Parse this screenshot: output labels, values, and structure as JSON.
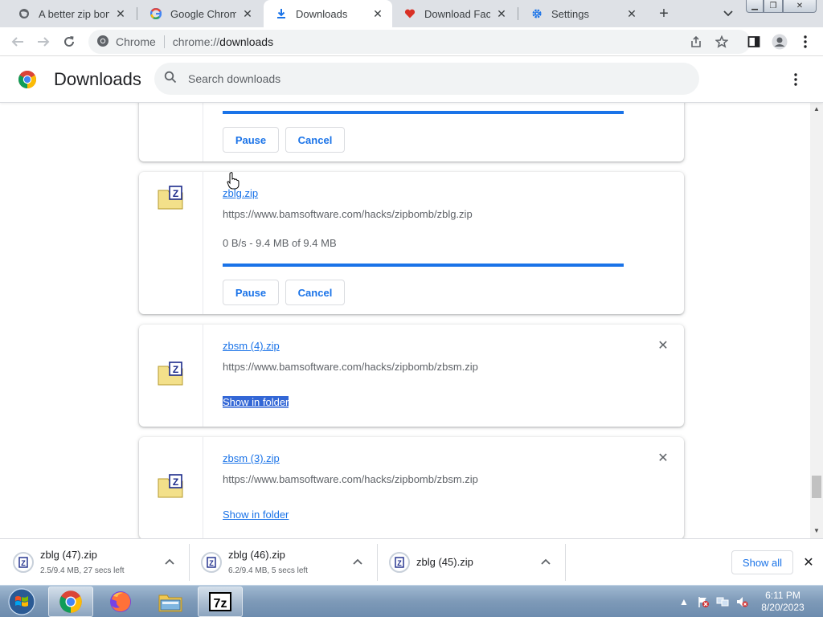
{
  "tabs": [
    {
      "title": "A better zip bomb",
      "icon": "globe-icon"
    },
    {
      "title": "Google Chrome b",
      "icon": "google-icon"
    },
    {
      "title": "Downloads",
      "icon": "download-icon",
      "active": true
    },
    {
      "title": "Download Facebo",
      "icon": "heart-icon"
    },
    {
      "title": "Settings",
      "icon": "gear-icon"
    }
  ],
  "toolbar": {
    "scheme_chip": "Chrome",
    "url_host": "chrome://",
    "url_path": "downloads"
  },
  "page": {
    "title": "Downloads",
    "search_placeholder": "Search downloads"
  },
  "downloads": [
    {
      "name": "",
      "url": "",
      "status": "",
      "progress": 1.0,
      "pause_label": "Pause",
      "cancel_label": "Cancel"
    },
    {
      "name": "zblg.zip",
      "url": "https://www.bamsoftware.com/hacks/zipbomb/zblg.zip",
      "status": "0 B/s - 9.4 MB of 9.4 MB",
      "progress": 1.0,
      "pause_label": "Pause",
      "cancel_label": "Cancel"
    },
    {
      "name": "zbsm (4).zip",
      "url": "https://www.bamsoftware.com/hacks/zipbomb/zbsm.zip",
      "action_label": "Show in folder"
    },
    {
      "name": "zbsm (3).zip",
      "url": "https://www.bamsoftware.com/hacks/zipbomb/zbsm.zip",
      "action_label": "Show in folder"
    }
  ],
  "shelf": {
    "items": [
      {
        "name": "zblg (47).zip",
        "sub": "2.5/9.4 MB, 27 secs left"
      },
      {
        "name": "zblg (46).zip",
        "sub": "6.2/9.4 MB, 5 secs left"
      },
      {
        "name": "zblg (45).zip",
        "sub": ""
      }
    ],
    "show_all_label": "Show all"
  },
  "taskbar": {
    "time": "6:11 PM",
    "date": "8/20/2023",
    "apps": [
      "chrome-icon",
      "firefox-icon",
      "file-explorer-icon",
      "7zip-icon"
    ]
  },
  "colors": {
    "accent": "#1a73e8",
    "selection": "#3367d6",
    "tabstrip": "#dee1e6"
  }
}
